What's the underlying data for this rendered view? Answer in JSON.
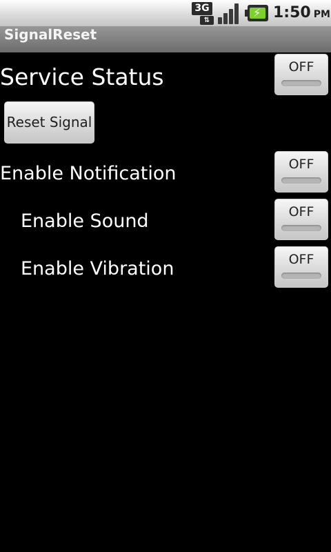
{
  "status_bar": {
    "network_label": "3G",
    "data_activity": "⇅",
    "time": "1:50",
    "ampm": "PM",
    "icons": [
      "3g-data-icon",
      "signal-strength-icon",
      "battery-charging-icon"
    ]
  },
  "app": {
    "title": "SignalReset"
  },
  "settings": {
    "service_status": {
      "label": "Service Status",
      "toggle": "OFF"
    },
    "reset_button": "Reset Signal",
    "notification": {
      "label": "Enable Notification",
      "toggle": "OFF"
    },
    "sound": {
      "label": "Enable Sound",
      "toggle": "OFF"
    },
    "vibration": {
      "label": "Enable Vibration",
      "toggle": "OFF"
    }
  },
  "colors": {
    "background": "#000000",
    "status_bar": "#d9d9d9",
    "title_bar": "#7f7f7f",
    "battery_fill": "#7dd12a"
  }
}
